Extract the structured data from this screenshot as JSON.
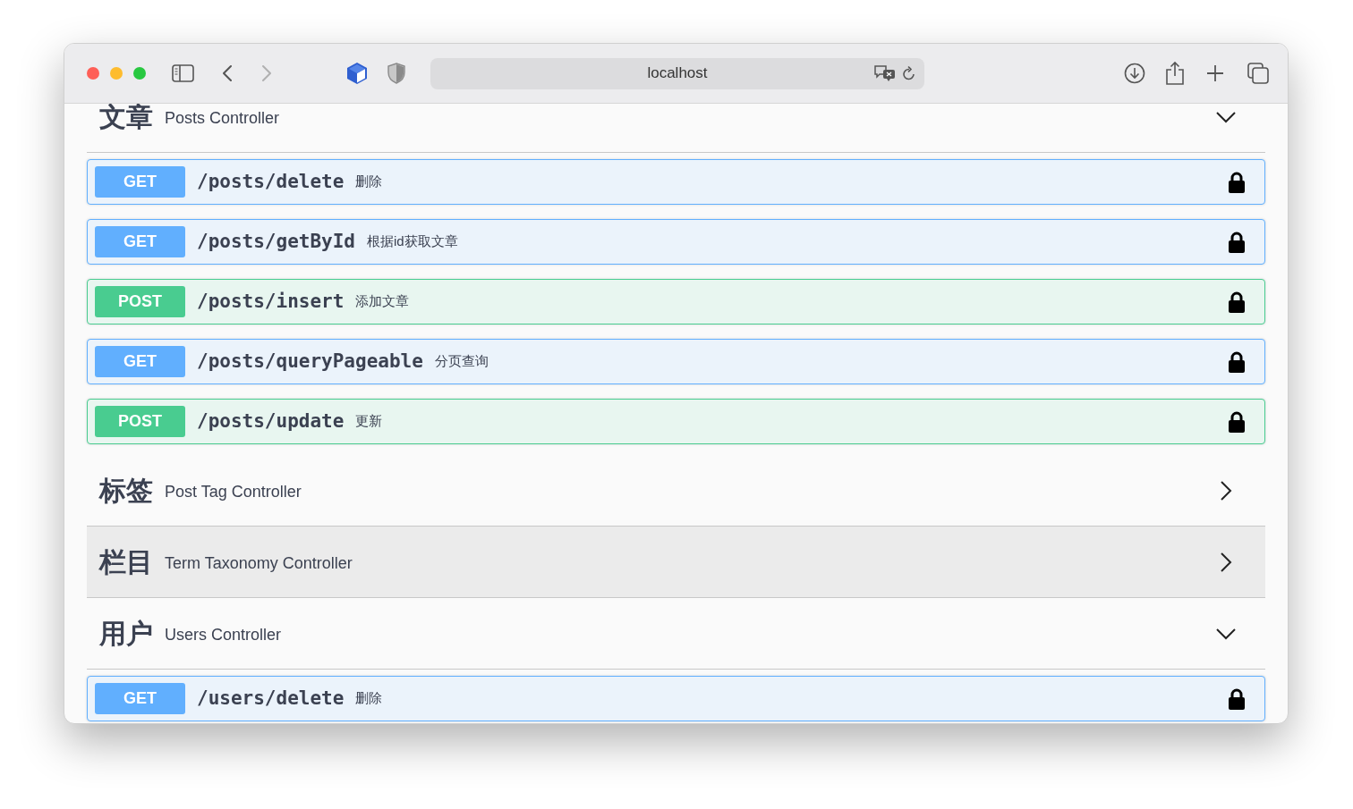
{
  "toolbar": {
    "url": "localhost",
    "back_disabled": false,
    "forward_disabled": true
  },
  "sections": [
    {
      "name": "文章",
      "description": "Posts Controller",
      "expanded": true,
      "hovered": false,
      "operations": [
        {
          "method": "GET",
          "path": "/posts/delete",
          "summary": "删除",
          "locked": true
        },
        {
          "method": "GET",
          "path": "/posts/getById",
          "summary": "根据id获取文章",
          "locked": true
        },
        {
          "method": "POST",
          "path": "/posts/insert",
          "summary": "添加文章",
          "locked": true
        },
        {
          "method": "GET",
          "path": "/posts/queryPageable",
          "summary": "分页查询",
          "locked": true
        },
        {
          "method": "POST",
          "path": "/posts/update",
          "summary": "更新",
          "locked": true
        }
      ]
    },
    {
      "name": "标签",
      "description": "Post Tag Controller",
      "expanded": false,
      "hovered": false
    },
    {
      "name": "栏目",
      "description": "Term Taxonomy Controller",
      "expanded": false,
      "hovered": true
    },
    {
      "name": "用户",
      "description": "Users Controller",
      "expanded": true,
      "hovered": false,
      "operations": [
        {
          "method": "GET",
          "path": "/users/delete",
          "summary": "删除",
          "locked": true
        }
      ]
    }
  ]
}
